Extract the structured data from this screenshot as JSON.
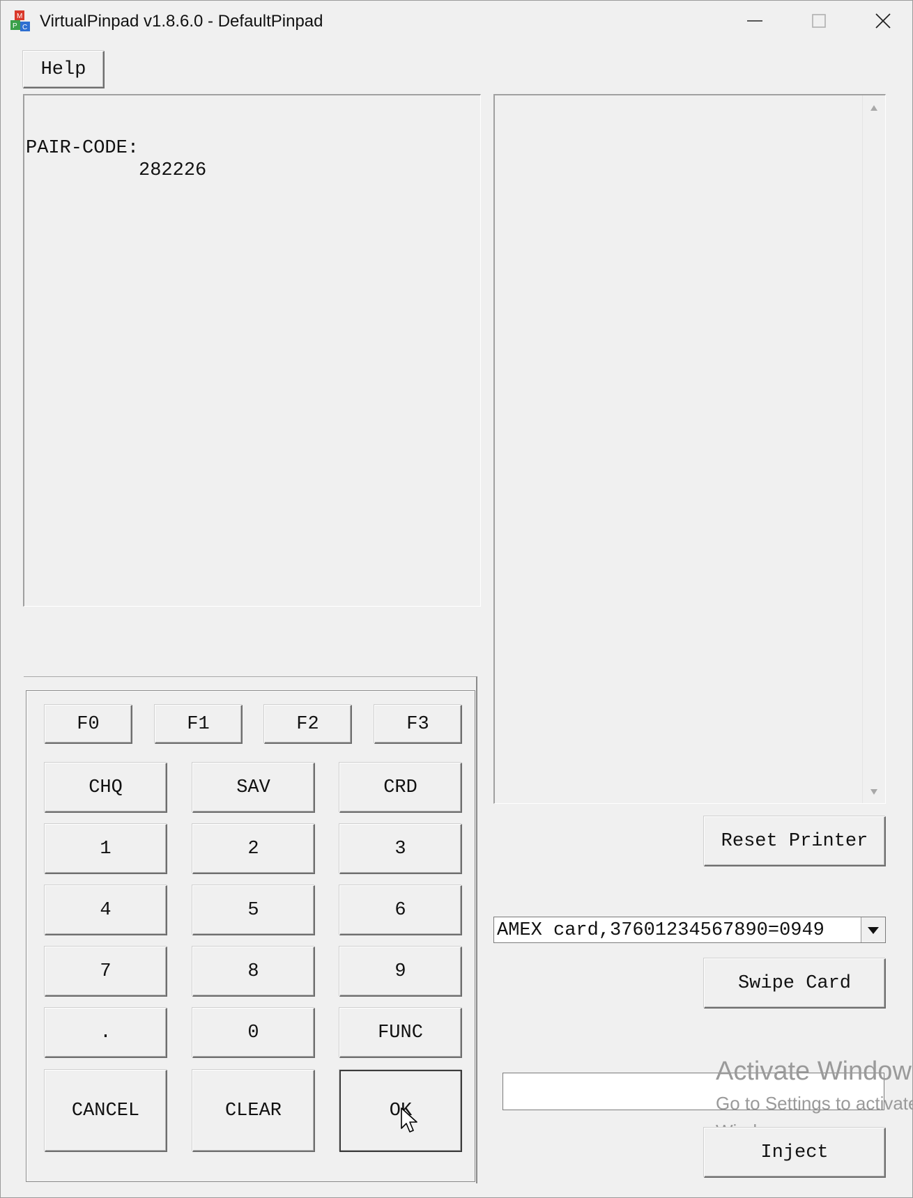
{
  "window": {
    "title": "VirtualPinpad v1.8.6.0 - DefaultPinpad",
    "controls": [
      "minimize-icon",
      "maximize-icon",
      "close-icon"
    ]
  },
  "menu": {
    "help_label": "Help"
  },
  "display": {
    "line1": "PAIR-CODE:",
    "line2": "          282226"
  },
  "keypad": {
    "function_keys": [
      "F0",
      "F1",
      "F2",
      "F3"
    ],
    "account_keys": [
      "CHQ",
      "SAV",
      "CRD"
    ],
    "row1": [
      "1",
      "2",
      "3"
    ],
    "row2": [
      "4",
      "5",
      "6"
    ],
    "row3": [
      "7",
      "8",
      "9"
    ],
    "row4": [
      ".",
      "0",
      "FUNC"
    ],
    "cancel_label": "CANCEL",
    "clear_label": "CLEAR",
    "ok_label": "OK"
  },
  "printer": {
    "reset_label": "Reset Printer"
  },
  "card": {
    "selected_option": "AMEX card,37601234567890=0949",
    "swipe_label": "Swipe Card"
  },
  "inject": {
    "input_value": "",
    "inject_label": "Inject"
  },
  "watermark": {
    "title": "Activate Windows",
    "line1": "Go to Settings to activate",
    "line2": "Windows."
  }
}
